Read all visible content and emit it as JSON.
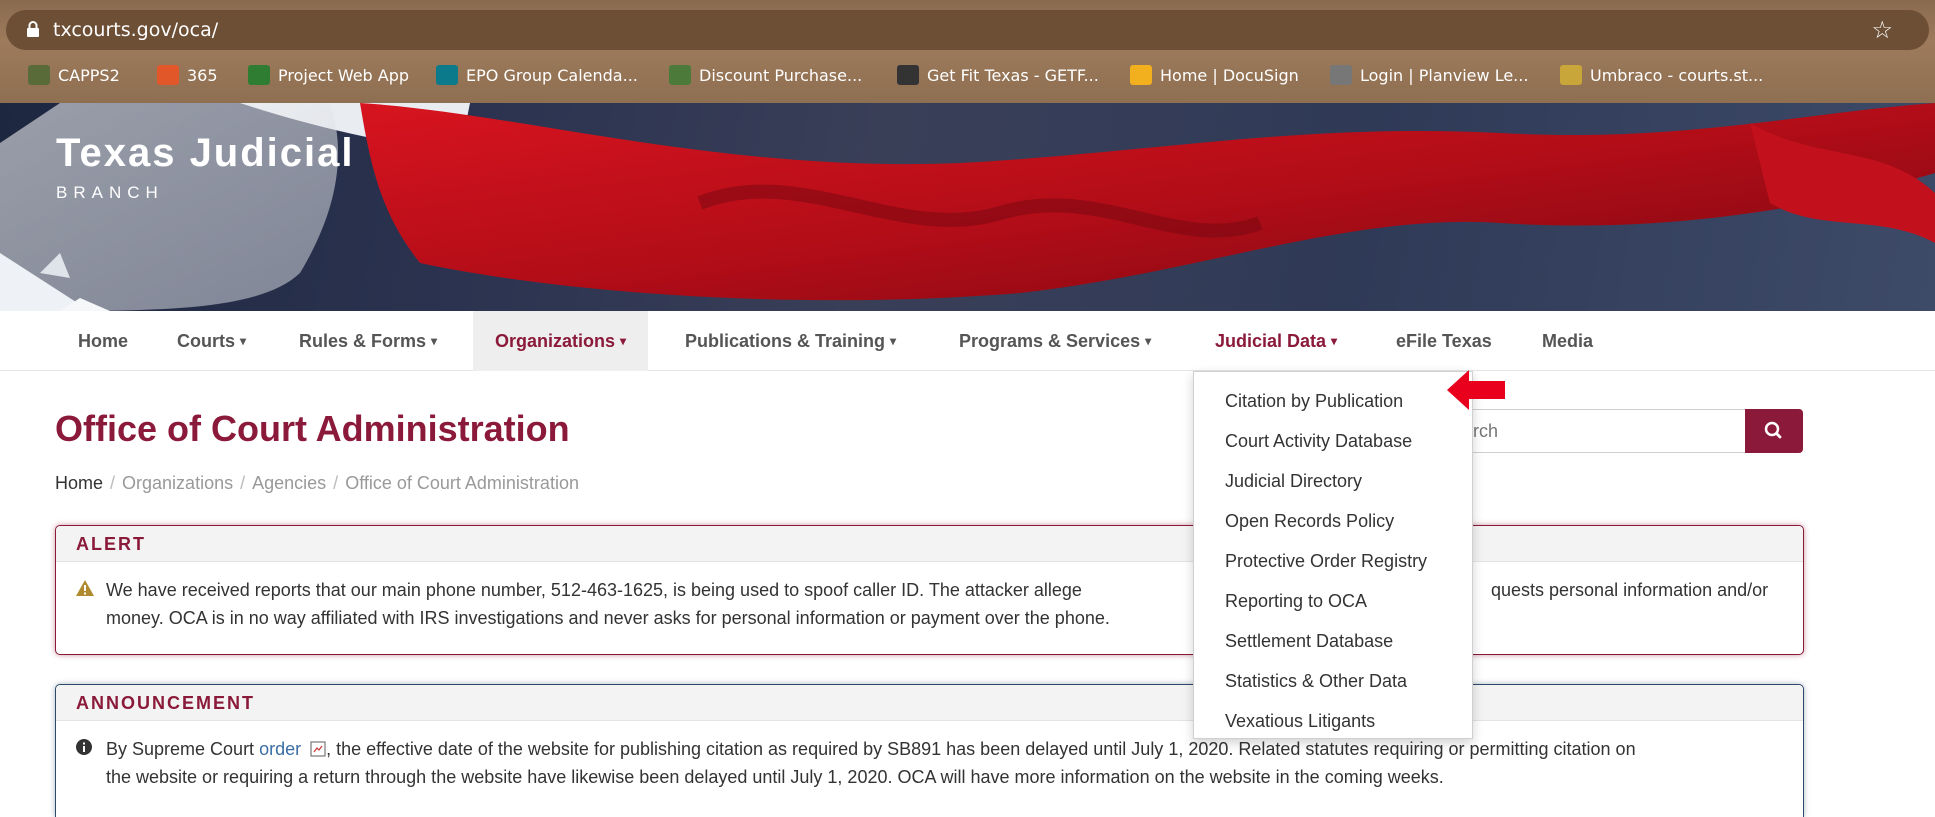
{
  "browser": {
    "url": "txcourts.gov/oca/",
    "bookmarks": [
      {
        "label": "CAPPS2",
        "icon": "capps-icon",
        "color": "#5a6b3a"
      },
      {
        "label": "365",
        "icon": "office-365-icon",
        "color": "#e2572a"
      },
      {
        "label": "Project Web App",
        "icon": "project-icon",
        "color": "#2e7d32"
      },
      {
        "label": "EPO Group Calenda...",
        "icon": "sharepoint-icon",
        "color": "#0b7a8a"
      },
      {
        "label": "Discount Purchase...",
        "icon": "shield-icon",
        "color": "#4c7a3a"
      },
      {
        "label": "Get Fit Texas - GETF...",
        "icon": "gft-icon",
        "color": "#333333"
      },
      {
        "label": "Home | DocuSign",
        "icon": "docusign-icon",
        "color": "#f2b01e"
      },
      {
        "label": "Login | Planview Le...",
        "icon": "planview-icon",
        "color": "#777777"
      },
      {
        "label": "Umbraco - courts.st...",
        "icon": "star-seal-icon",
        "color": "#c9a63a"
      }
    ]
  },
  "site": {
    "title": "Texas Judicial",
    "subtitle": "BRANCH"
  },
  "nav": {
    "items": [
      {
        "label": "Home",
        "caret": false,
        "active": false
      },
      {
        "label": "Courts",
        "caret": true,
        "active": false
      },
      {
        "label": "Rules & Forms",
        "caret": true,
        "active": false
      },
      {
        "label": "Organizations",
        "caret": true,
        "active": true
      },
      {
        "label": "Publications & Training",
        "caret": true,
        "active": false
      },
      {
        "label": "Programs & Services",
        "caret": true,
        "active": false
      },
      {
        "label": "Judicial Data",
        "caret": true,
        "active": false
      },
      {
        "label": "eFile Texas",
        "caret": false,
        "active": false
      },
      {
        "label": "Media",
        "caret": false,
        "active": false
      }
    ],
    "caret_glyph": "▾"
  },
  "dropdown": {
    "items": [
      "Citation by Publication",
      "Court Activity Database",
      "Judicial Directory",
      "Open Records Policy",
      "Protective Order Registry",
      "Reporting to OCA",
      "Settlement Database",
      "Statistics & Other Data",
      "Vexatious Litigants"
    ]
  },
  "page": {
    "title": "Office of Court Administration",
    "breadcrumb": [
      "Home",
      "Organizations",
      "Agencies",
      "Office of Court Administration"
    ],
    "breadcrumb_sep": "/",
    "search_placeholder": "earch"
  },
  "alert": {
    "heading": "ALERT",
    "line1a": "We have received reports that our main phone number, 512-463-1625, is being used to spoof caller ID. The attacker allege",
    "line1b": "quests personal information and/or",
    "line2": "money. OCA is in no way affiliated with IRS investigations and never asks for personal information or payment over the phone."
  },
  "announcement": {
    "heading": "ANNOUNCEMENT",
    "text_before": "By Supreme Court ",
    "link": "order",
    "text_after": ", the effective date of the website for publishing citation as required by SB891 has been delayed until July 1, 2020. Related statutes requiring or permitting citation on",
    "line2": "the website or requiring a return through the website have likewise been delayed until July 1, 2020. OCA will have more information on the website in the coming weeks."
  },
  "colors": {
    "brand": "#8b1a3a",
    "arrow": "#e8001c"
  }
}
